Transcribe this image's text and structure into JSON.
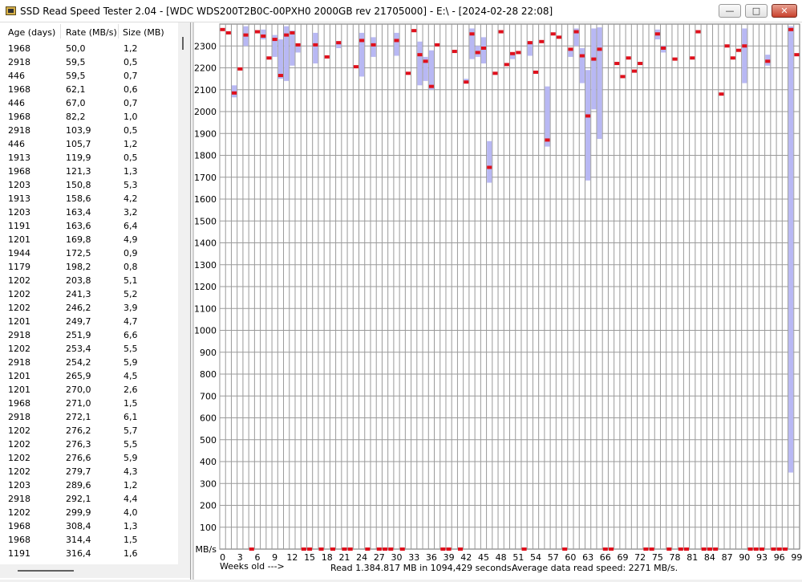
{
  "window": {
    "title": "SSD Read Speed Tester 2.04 - [WDC WDS200T2B0C-00PXH0 2000GB rev 21705000] - E:\\ - [2024-02-28 22:08]",
    "minimize_symbol": "—",
    "maximize_symbol": "□",
    "close_symbol": "✕"
  },
  "table": {
    "columns": [
      "Age (days)",
      "Rate (MB/s)",
      "Size (MB)"
    ],
    "rows": [
      [
        "1968",
        "50,0",
        "1,2"
      ],
      [
        "2918",
        "59,5",
        "0,5"
      ],
      [
        "446",
        "59,5",
        "0,7"
      ],
      [
        "1968",
        "62,1",
        "0,6"
      ],
      [
        "446",
        "67,0",
        "0,7"
      ],
      [
        "1968",
        "82,2",
        "1,0"
      ],
      [
        "2918",
        "103,9",
        "0,5"
      ],
      [
        "446",
        "105,7",
        "1,2"
      ],
      [
        "1913",
        "119,9",
        "0,5"
      ],
      [
        "1968",
        "121,3",
        "1,3"
      ],
      [
        "1203",
        "150,8",
        "5,3"
      ],
      [
        "1913",
        "158,6",
        "4,2"
      ],
      [
        "1203",
        "163,4",
        "3,2"
      ],
      [
        "1191",
        "163,6",
        "6,4"
      ],
      [
        "1201",
        "169,8",
        "4,9"
      ],
      [
        "1944",
        "172,5",
        "0,9"
      ],
      [
        "1179",
        "198,2",
        "0,8"
      ],
      [
        "1202",
        "203,8",
        "5,1"
      ],
      [
        "1202",
        "241,3",
        "5,2"
      ],
      [
        "1202",
        "246,2",
        "3,9"
      ],
      [
        "1201",
        "249,7",
        "4,7"
      ],
      [
        "2918",
        "251,9",
        "6,6"
      ],
      [
        "1202",
        "253,4",
        "5,5"
      ],
      [
        "2918",
        "254,2",
        "5,9"
      ],
      [
        "1201",
        "265,9",
        "4,5"
      ],
      [
        "1201",
        "270,0",
        "2,6"
      ],
      [
        "1968",
        "271,0",
        "1,5"
      ],
      [
        "2918",
        "272,1",
        "6,1"
      ],
      [
        "1202",
        "276,2",
        "5,7"
      ],
      [
        "1202",
        "276,3",
        "5,5"
      ],
      [
        "1202",
        "276,6",
        "5,9"
      ],
      [
        "1202",
        "279,7",
        "4,3"
      ],
      [
        "1203",
        "289,6",
        "1,2"
      ],
      [
        "2918",
        "292,1",
        "4,4"
      ],
      [
        "1202",
        "299,9",
        "4,0"
      ],
      [
        "1968",
        "308,4",
        "1,3"
      ],
      [
        "1968",
        "314,4",
        "1,5"
      ],
      [
        "1191",
        "316,4",
        "1,6"
      ]
    ]
  },
  "chart_data": {
    "type": "bar",
    "description_units": "MB/s per week of file age",
    "y_unit_label": "MB/s",
    "ylim": [
      0,
      2400
    ],
    "y_ticks": [
      100,
      200,
      300,
      400,
      500,
      600,
      700,
      800,
      900,
      1000,
      1100,
      1200,
      1300,
      1400,
      1500,
      1600,
      1700,
      1800,
      1900,
      2000,
      2100,
      2200,
      2300
    ],
    "x_ticks": [
      0,
      3,
      6,
      9,
      12,
      15,
      18,
      21,
      24,
      27,
      30,
      33,
      36,
      39,
      42,
      45,
      48,
      51,
      54,
      57,
      60,
      63,
      66,
      69,
      72,
      75,
      78,
      81,
      84,
      87,
      90,
      93,
      96,
      99
    ],
    "xlim": [
      0,
      99
    ],
    "grid": true,
    "series": [
      {
        "week": 0,
        "avg": 2375
      },
      {
        "week": 1,
        "avg": 2360
      },
      {
        "week": 2,
        "avg": 2085,
        "min": 2065,
        "max": 2120
      },
      {
        "week": 3,
        "avg": 2195
      },
      {
        "week": 4,
        "avg": 2350,
        "min": 2300,
        "max": 2390
      },
      {
        "week": 5,
        "avg": 0
      },
      {
        "week": 6,
        "avg": 2365
      },
      {
        "week": 7,
        "avg": 2345,
        "min": 2330,
        "max": 2375
      },
      {
        "week": 8,
        "avg": 2245
      },
      {
        "week": 9,
        "avg": 2330,
        "min": 2250,
        "max": 2350
      },
      {
        "week": 10,
        "avg": 2165,
        "min": 2150,
        "max": 2330
      },
      {
        "week": 11,
        "avg": 2350,
        "min": 2140,
        "max": 2390
      },
      {
        "week": 12,
        "avg": 2360,
        "min": 2210,
        "max": 2370
      },
      {
        "week": 13,
        "avg": 2305,
        "min": 2270,
        "max": 2310
      },
      {
        "week": 14,
        "avg": 0
      },
      {
        "week": 15,
        "avg": 0
      },
      {
        "week": 16,
        "avg": 2305,
        "min": 2220,
        "max": 2360
      },
      {
        "week": 17,
        "avg": 0
      },
      {
        "week": 18,
        "avg": 2250
      },
      {
        "week": 19,
        "avg": 0
      },
      {
        "week": 20,
        "avg": 2315,
        "min": 2290,
        "max": 2320
      },
      {
        "week": 21,
        "avg": 0
      },
      {
        "week": 22,
        "avg": 0
      },
      {
        "week": 23,
        "avg": 2205
      },
      {
        "week": 24,
        "avg": 2325,
        "min": 2160,
        "max": 2360
      },
      {
        "week": 25,
        "avg": 0
      },
      {
        "week": 26,
        "avg": 2305,
        "min": 2250,
        "max": 2340
      },
      {
        "week": 27,
        "avg": 0
      },
      {
        "week": 28,
        "avg": 0
      },
      {
        "week": 29,
        "avg": 0
      },
      {
        "week": 30,
        "avg": 2325,
        "min": 2255,
        "max": 2360
      },
      {
        "week": 31,
        "avg": 0
      },
      {
        "week": 32,
        "avg": 2175
      },
      {
        "week": 33,
        "avg": 2370
      },
      {
        "week": 34,
        "avg": 2260,
        "min": 2120,
        "max": 2320
      },
      {
        "week": 35,
        "avg": 2230,
        "min": 2140,
        "max": 2250
      },
      {
        "week": 36,
        "avg": 2115,
        "min": 2100,
        "max": 2280
      },
      {
        "week": 37,
        "avg": 2305
      },
      {
        "week": 38,
        "avg": 0
      },
      {
        "week": 39,
        "avg": 0
      },
      {
        "week": 40,
        "avg": 2275
      },
      {
        "week": 41,
        "avg": 0
      },
      {
        "week": 42,
        "avg": 2135,
        "min": 2130,
        "max": 2150
      },
      {
        "week": 43,
        "avg": 2355,
        "min": 2240,
        "max": 2380
      },
      {
        "week": 44,
        "avg": 2270,
        "min": 2250,
        "max": 2300
      },
      {
        "week": 45,
        "avg": 2290,
        "min": 2220,
        "max": 2340
      },
      {
        "week": 46,
        "avg": 1745,
        "min": 1675,
        "max": 1865
      },
      {
        "week": 47,
        "avg": 2175
      },
      {
        "week": 48,
        "avg": 2365
      },
      {
        "week": 49,
        "avg": 2215
      },
      {
        "week": 50,
        "avg": 2265,
        "min": 2240,
        "max": 2270
      },
      {
        "week": 51,
        "avg": 2270
      },
      {
        "week": 52,
        "avg": 0
      },
      {
        "week": 53,
        "avg": 2315,
        "min": 2255,
        "max": 2320
      },
      {
        "week": 54,
        "avg": 2180
      },
      {
        "week": 55,
        "avg": 2320
      },
      {
        "week": 56,
        "avg": 1870,
        "min": 1840,
        "max": 2115
      },
      {
        "week": 57,
        "avg": 2355
      },
      {
        "week": 58,
        "avg": 2340
      },
      {
        "week": 59,
        "avg": 0
      },
      {
        "week": 60,
        "avg": 2285,
        "min": 2250,
        "max": 2290
      },
      {
        "week": 61,
        "avg": 2365,
        "min": 2300,
        "max": 2380
      },
      {
        "week": 62,
        "avg": 2255,
        "min": 2130,
        "max": 2290
      },
      {
        "week": 63,
        "avg": 1980,
        "min": 1685,
        "max": 2190
      },
      {
        "week": 64,
        "avg": 2240,
        "min": 2010,
        "max": 2380
      },
      {
        "week": 65,
        "avg": 2285,
        "min": 1875,
        "max": 2385
      },
      {
        "week": 66,
        "avg": 0
      },
      {
        "week": 67,
        "avg": 0
      },
      {
        "week": 68,
        "avg": 2220
      },
      {
        "week": 69,
        "avg": 2160
      },
      {
        "week": 70,
        "avg": 2245
      },
      {
        "week": 71,
        "avg": 2185
      },
      {
        "week": 72,
        "avg": 2220
      },
      {
        "week": 73,
        "avg": 0
      },
      {
        "week": 74,
        "avg": 0
      },
      {
        "week": 75,
        "avg": 2355,
        "min": 2330,
        "max": 2375
      },
      {
        "week": 76,
        "avg": 2290,
        "min": 2270,
        "max": 2300
      },
      {
        "week": 77,
        "avg": 0
      },
      {
        "week": 78,
        "avg": 2240
      },
      {
        "week": 79,
        "avg": 0
      },
      {
        "week": 80,
        "avg": 0
      },
      {
        "week": 81,
        "avg": 2245
      },
      {
        "week": 82,
        "avg": 2365
      },
      {
        "week": 83,
        "avg": 0
      },
      {
        "week": 84,
        "avg": 0
      },
      {
        "week": 85,
        "avg": 0
      },
      {
        "week": 86,
        "avg": 2080
      },
      {
        "week": 87,
        "avg": 2300
      },
      {
        "week": 88,
        "avg": 2245
      },
      {
        "week": 89,
        "avg": 2280
      },
      {
        "week": 90,
        "avg": 2300,
        "min": 2130,
        "max": 2380
      },
      {
        "week": 91,
        "avg": 0
      },
      {
        "week": 92,
        "avg": 0
      },
      {
        "week": 93,
        "avg": 0
      },
      {
        "week": 94,
        "avg": 2230,
        "min": 2210,
        "max": 2260
      },
      {
        "week": 95,
        "avg": 0
      },
      {
        "week": 96,
        "avg": 0
      },
      {
        "week": 97,
        "avg": 0
      },
      {
        "week": 98,
        "avg": 2375,
        "min": 350,
        "max": 2390
      },
      {
        "week": 99,
        "avg": 2260
      }
    ]
  },
  "footer": {
    "weeks_label": "Weeks old --->",
    "read_summary": "Read 1.384.817 MB in 1094,429 seconds.",
    "avg_speed": "Average data read speed: 2271 MB/s."
  },
  "colors": {
    "avg_marker": "#e0101c",
    "range_band": "#b8b8f4",
    "grid": "#9a9a9a"
  }
}
